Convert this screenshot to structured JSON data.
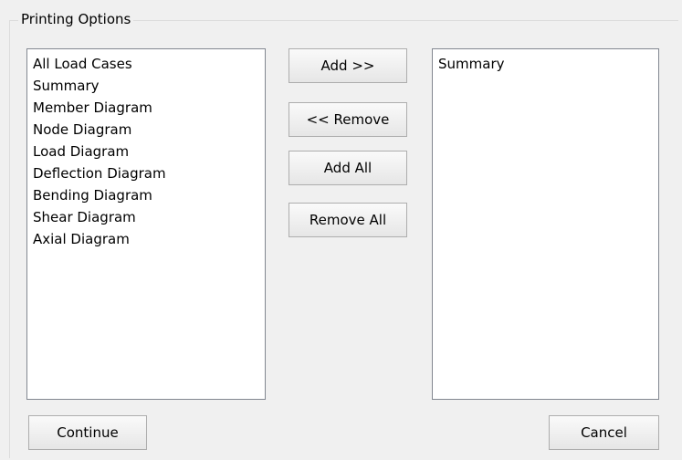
{
  "group": {
    "title": "Printing Options"
  },
  "available_list": {
    "items": [
      "All Load Cases",
      "Summary",
      "Member Diagram",
      "Node Diagram",
      "Load Diagram",
      "Deflection Diagram",
      "Bending Diagram",
      "Shear Diagram",
      "Axial Diagram"
    ]
  },
  "selected_list": {
    "items": [
      "Summary"
    ]
  },
  "buttons": {
    "add": "Add >>",
    "remove": "<< Remove",
    "add_all": "Add All",
    "remove_all": "Remove All",
    "continue": "Continue",
    "cancel": "Cancel"
  }
}
